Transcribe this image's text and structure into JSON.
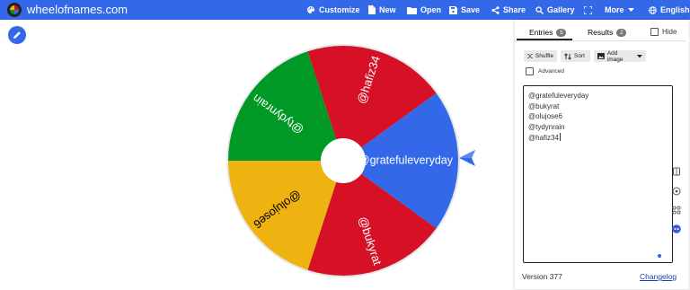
{
  "app": {
    "brand": "wheelofnames.com"
  },
  "nav": [
    {
      "id": "customize",
      "label": "Customize",
      "icon": "palette-icon"
    },
    {
      "id": "new",
      "label": "New",
      "icon": "new-file-icon"
    },
    {
      "id": "open",
      "label": "Open",
      "icon": "folder-icon"
    },
    {
      "id": "save",
      "label": "Save",
      "icon": "save-icon"
    },
    {
      "id": "share",
      "label": "Share",
      "icon": "share-icon"
    },
    {
      "id": "gallery",
      "label": "Gallery",
      "icon": "search-icon"
    },
    {
      "id": "fullscreen",
      "label": "",
      "icon": "fullscreen-icon"
    },
    {
      "id": "more",
      "label": "More",
      "icon": "chevron-down-icon"
    },
    {
      "id": "language",
      "label": "English",
      "icon": "globe-icon"
    }
  ],
  "wheel": {
    "entries": [
      "@gratefuleveryday",
      "@bukyrat",
      "@olujose6",
      "@tydynrain",
      "@hafiz34"
    ],
    "colors": [
      "#3369e8",
      "#d61126",
      "#eeb211",
      "#009925",
      "#d61126"
    ]
  },
  "panel": {
    "tabs": {
      "entries": "Entries",
      "entries_count": "5",
      "results": "Results",
      "results_count": "2"
    },
    "hide_label": "Hide",
    "shuffle": "Shuffle",
    "sort": "Sort",
    "add_image": "Add image",
    "advanced": "Advanced",
    "textarea_lines": [
      "@gratefuleveryday",
      "@bukyrat",
      "@olujose6",
      "@tydynrain",
      "@hafiz34"
    ],
    "version": "Version 377",
    "changelog": "Changelog"
  },
  "side_icons": [
    "book-icon",
    "help-icon",
    "apps-icon",
    "feedback-icon"
  ]
}
